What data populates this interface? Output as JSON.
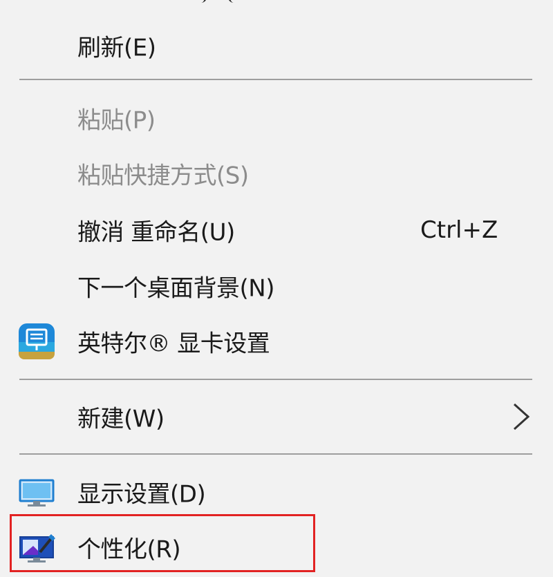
{
  "menu": {
    "items": [
      {
        "label": "刷新(E)",
        "enabled": true
      },
      {
        "label": "粘贴(P)",
        "enabled": false
      },
      {
        "label": "粘贴快捷方式(S)",
        "enabled": false
      },
      {
        "label": "撤消 重命名(U)",
        "shortcut": "Ctrl+Z",
        "enabled": true
      },
      {
        "label": "下一个桌面背景(N)",
        "enabled": true
      },
      {
        "label": "英特尔® 显卡设置",
        "icon": "intel-graphics-icon",
        "enabled": true
      },
      {
        "label": "新建(W)",
        "has_submenu": true,
        "icon": "chevron-right-icon",
        "enabled": true
      },
      {
        "label": "显示设置(D)",
        "icon": "display-settings-icon",
        "enabled": true
      },
      {
        "label": "个性化(R)",
        "icon": "personalize-icon",
        "enabled": true,
        "highlighted": true
      }
    ]
  },
  "colors": {
    "menu_background": "#f2f2f2",
    "text": "#1a1a1a",
    "disabled_text": "#8c8c8c",
    "separator": "#9e9e9e",
    "highlight_border": "#e22222"
  }
}
